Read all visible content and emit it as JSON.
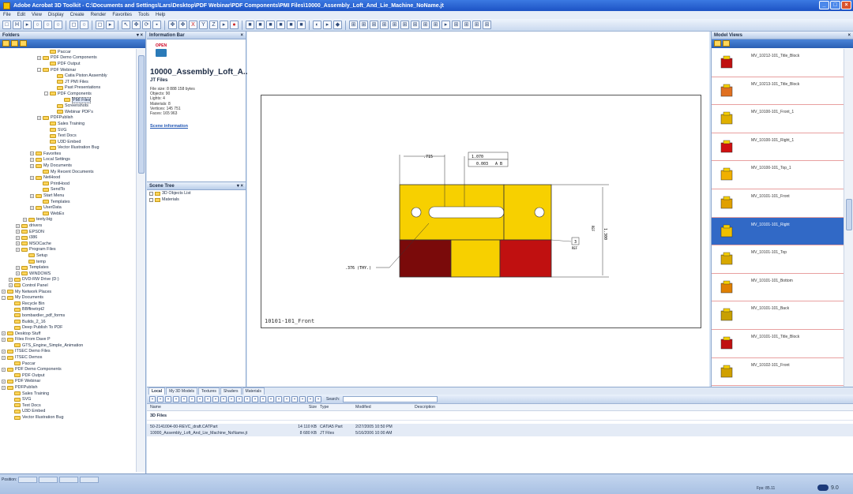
{
  "window": {
    "title": "Adobe Acrobat 3D Toolkit - C:\\Documents and Settings\\Lars\\Desktop\\PDF Webinar\\PDF Components\\PMI Files\\10000_Assembly_Loft_And_Lie_Machine_NoName.jt"
  },
  "menu": [
    "File",
    "Edit",
    "View",
    "Display",
    "Create",
    "Render",
    "Favorites",
    "Tools",
    "Help"
  ],
  "folders": {
    "title": "Folders",
    "items": [
      {
        "label": "Paccar",
        "indent": 6,
        "exp": ""
      },
      {
        "label": "PDF Demo Components",
        "indent": 5,
        "exp": "+"
      },
      {
        "label": "PDF Output",
        "indent": 6,
        "exp": ""
      },
      {
        "label": "PDF Webinar",
        "indent": 5,
        "exp": "-"
      },
      {
        "label": "Catia Piston Assembly",
        "indent": 7,
        "exp": ""
      },
      {
        "label": "JT PMI Files",
        "indent": 7,
        "exp": ""
      },
      {
        "label": "Past Presentations",
        "indent": 7,
        "exp": ""
      },
      {
        "label": "PDF Components",
        "indent": 6,
        "exp": "-"
      },
      {
        "label": "PMI Files",
        "indent": 8,
        "exp": "",
        "selected": true
      },
      {
        "label": "Screenshots",
        "indent": 7,
        "exp": ""
      },
      {
        "label": "Webinar PDF's",
        "indent": 7,
        "exp": ""
      },
      {
        "label": "PDFPublish",
        "indent": 5,
        "exp": "+"
      },
      {
        "label": "Sales Training",
        "indent": 6,
        "exp": ""
      },
      {
        "label": "SVG",
        "indent": 6,
        "exp": ""
      },
      {
        "label": "Text Docs",
        "indent": 6,
        "exp": ""
      },
      {
        "label": "U3D Embed",
        "indent": 6,
        "exp": ""
      },
      {
        "label": "Vector Illustration Bug",
        "indent": 6,
        "exp": ""
      },
      {
        "label": "Favorites",
        "indent": 4,
        "exp": "+"
      },
      {
        "label": "Local Settings",
        "indent": 4,
        "exp": "+"
      },
      {
        "label": "My Documents",
        "indent": 4,
        "exp": "+"
      },
      {
        "label": "My Recent Documents",
        "indent": 5,
        "exp": ""
      },
      {
        "label": "NetHood",
        "indent": 4,
        "exp": "+"
      },
      {
        "label": "PrintHood",
        "indent": 5,
        "exp": ""
      },
      {
        "label": "SendTo",
        "indent": 5,
        "exp": ""
      },
      {
        "label": "Start Menu",
        "indent": 4,
        "exp": "+"
      },
      {
        "label": "Templates",
        "indent": 5,
        "exp": ""
      },
      {
        "label": "UserData",
        "indent": 4,
        "exp": "+"
      },
      {
        "label": "WebEx",
        "indent": 5,
        "exp": ""
      },
      {
        "label": "teety.big",
        "indent": 3,
        "exp": "+"
      },
      {
        "label": "drivers",
        "indent": 2,
        "exp": "+"
      },
      {
        "label": "EPSON",
        "indent": 2,
        "exp": "+"
      },
      {
        "label": "i386",
        "indent": 2,
        "exp": "+"
      },
      {
        "label": "MSOCache",
        "indent": 2,
        "exp": "+"
      },
      {
        "label": "Program Files",
        "indent": 2,
        "exp": "+"
      },
      {
        "label": "Setup",
        "indent": 3,
        "exp": ""
      },
      {
        "label": "temp",
        "indent": 3,
        "exp": ""
      },
      {
        "label": "Templates",
        "indent": 2,
        "exp": "+"
      },
      {
        "label": "WINDOWS",
        "indent": 2,
        "exp": "+"
      },
      {
        "label": "DVD-RW Drive (D:)",
        "indent": 1,
        "exp": "+"
      },
      {
        "label": "Control Panel",
        "indent": 1,
        "exp": "+"
      },
      {
        "label": "My Network Places",
        "indent": 0,
        "exp": "+"
      },
      {
        "label": "My Documents",
        "indent": 0,
        "exp": "-"
      },
      {
        "label": "Recycle Bin",
        "indent": 1,
        "exp": ""
      },
      {
        "label": "BBffinetrpt2",
        "indent": 1,
        "exp": ""
      },
      {
        "label": "bombardier_pdf_forms",
        "indent": 1,
        "exp": ""
      },
      {
        "label": "Builds_2_16",
        "indent": 1,
        "exp": ""
      },
      {
        "label": "Deep Publish To PDF",
        "indent": 1,
        "exp": ""
      },
      {
        "label": "Desktop Stuff",
        "indent": 0,
        "exp": "+"
      },
      {
        "label": "Files From Dave P",
        "indent": 0,
        "exp": "+"
      },
      {
        "label": "GTS_Engine_Simple_Animation",
        "indent": 1,
        "exp": ""
      },
      {
        "label": "ITSEC Demo Files",
        "indent": 0,
        "exp": "+"
      },
      {
        "label": "ITSEC Demos",
        "indent": 0,
        "exp": "+"
      },
      {
        "label": "Paccar",
        "indent": 1,
        "exp": ""
      },
      {
        "label": "PDF Demo Components",
        "indent": 0,
        "exp": "+"
      },
      {
        "label": "PDF Output",
        "indent": 1,
        "exp": ""
      },
      {
        "label": "PDF Webinar",
        "indent": 0,
        "exp": "+"
      },
      {
        "label": "PDFPublish",
        "indent": 0,
        "exp": "+"
      },
      {
        "label": "Sales Training",
        "indent": 1,
        "exp": ""
      },
      {
        "label": "SVG",
        "indent": 1,
        "exp": ""
      },
      {
        "label": "Text Docs",
        "indent": 1,
        "exp": ""
      },
      {
        "label": "U3D Embed",
        "indent": 1,
        "exp": ""
      },
      {
        "label": "Vector Illustration Bug",
        "indent": 1,
        "exp": ""
      }
    ]
  },
  "infobar": {
    "title": "Information Bar",
    "open_label": "OPEN",
    "file_title": "10000_Assembly_Loft_A...",
    "file_type": "JT Files",
    "lines": [
      "File size: 8 888 158 bytes",
      "Objects: 90",
      "Lights: 4",
      "Materials: 8",
      "Vertices: 145 751",
      "Faces: 165 963"
    ],
    "link": "Scene information"
  },
  "scene_tree": {
    "title": "Scene Tree",
    "items": [
      "3D Objects List",
      "Materials"
    ]
  },
  "drawing": {
    "caption": "10101-101_Front",
    "dims": {
      "d1": ".715",
      "d2": "1.070",
      "d3": "0.003",
      "d4": "A B",
      "d5": ".376 (THY.)",
      "d6": "1.300",
      "d7": "REF",
      "d8": "REF",
      "d9": "3"
    }
  },
  "model_views": {
    "title": "Model Views",
    "items": [
      {
        "label": "MV_10212-101_Title_Block"
      },
      {
        "label": "MV_10213-101_Title_Block"
      },
      {
        "label": "MV_10100-101_Front_1"
      },
      {
        "label": "MV_10100-101_Right_1"
      },
      {
        "label": "MV_10100-101_Top_1"
      },
      {
        "label": "MV_10101-101_Front"
      },
      {
        "label": "MV_10101-101_Right",
        "selected": true
      },
      {
        "label": "MV_10101-101_Top"
      },
      {
        "label": "MV_10101-101_Bottom"
      },
      {
        "label": "MV_10101-101_Back"
      },
      {
        "label": "MV_10101-101_Title_Block"
      },
      {
        "label": "MV_10102-101_Front"
      }
    ]
  },
  "lower": {
    "tabs": [
      "Local",
      "My 3D Models",
      "Textures",
      "Shaders",
      "Materials"
    ],
    "search_label": "Search:",
    "columns": [
      "Name",
      "Size",
      "Type",
      "Modified",
      "Description"
    ],
    "group": "3D Files",
    "rows": [
      {
        "name": "50-2141004-00-REVC_draft.CATPart",
        "size": "14 110 KB",
        "type": "CATIA5 Part",
        "modified": "2/27/2005 10:50 PM",
        "desc": ""
      },
      {
        "name": "10000_Assembly_Loft_And_Lie_Machine_NoName.jt",
        "size": "8 680 KB",
        "type": "JT Files",
        "modified": "5/16/2006 10:00 AM",
        "desc": ""
      }
    ]
  },
  "status": {
    "position_label": "Position:",
    "fps": "Fps: 85.11",
    "version": "9.0"
  },
  "colors": {
    "accent": "#3169c6",
    "part_yellow": "#f7d000",
    "part_red": "#c01010",
    "part_dark": "#7a0a0a"
  }
}
